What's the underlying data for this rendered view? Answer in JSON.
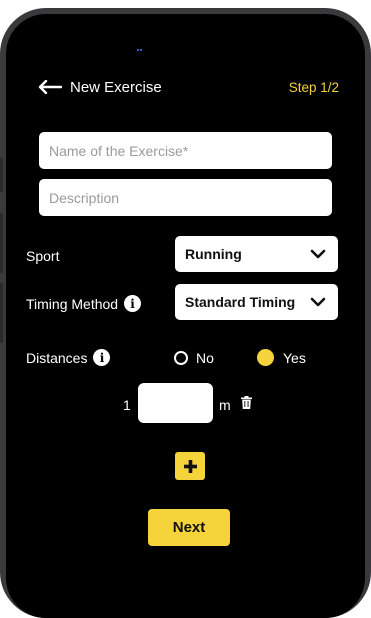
{
  "header": {
    "title": "New Exercise",
    "step": "Step 1/2"
  },
  "form": {
    "name_placeholder": "Name of the Exercise*",
    "description_placeholder": "Description",
    "sport_label": "Sport",
    "sport_value": "Running",
    "timing_label": "Timing Method",
    "timing_value": "Standard Timing",
    "distances_label": "Distances",
    "option_no": "No",
    "option_yes": "Yes",
    "selected_option": "Yes",
    "distance_index": "1",
    "distance_unit": "m"
  },
  "buttons": {
    "next": "Next"
  },
  "colors": {
    "accent": "#f5d33a",
    "background": "#000000"
  },
  "icons": [
    "back-arrow-icon",
    "info-icon",
    "chevron-down-icon",
    "trash-icon",
    "plus-icon"
  ]
}
